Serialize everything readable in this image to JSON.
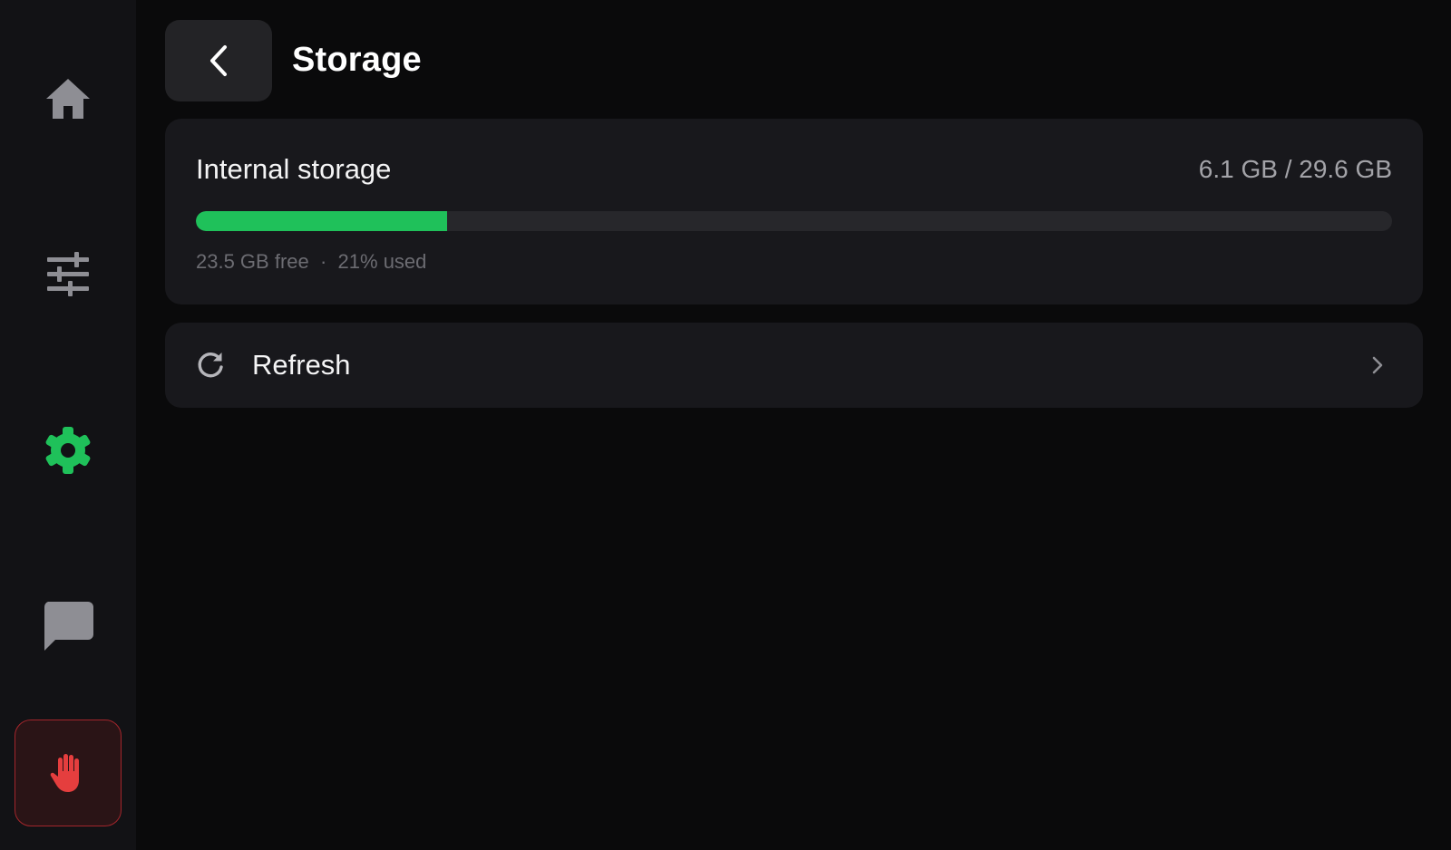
{
  "sidebar": {
    "items": [
      {
        "name": "home",
        "icon": "home-icon",
        "active": false
      },
      {
        "name": "controls",
        "icon": "sliders-icon",
        "active": false
      },
      {
        "name": "settings",
        "icon": "gear-icon",
        "active": true
      },
      {
        "name": "chat",
        "icon": "chat-bubble-icon",
        "active": false
      },
      {
        "name": "stop",
        "icon": "hand-stop-icon",
        "active": false
      }
    ]
  },
  "header": {
    "back_icon": "chevron-left-icon",
    "title": "Storage"
  },
  "storage": {
    "label": "Internal storage",
    "usage_text": "6.1 GB / 29.6 GB",
    "used_fraction": 0.21,
    "free_text": "23.5 GB free",
    "separator": "·",
    "used_text": "21% used"
  },
  "refresh": {
    "icon": "refresh-icon",
    "label": "Refresh",
    "chevron": "chevron-right-icon"
  },
  "colors": {
    "accent_green": "#1fc15a",
    "stop_red": "#e53e3e",
    "icon_gray": "#8e8e94",
    "background": "#0a0a0b",
    "card": "#18181c"
  }
}
